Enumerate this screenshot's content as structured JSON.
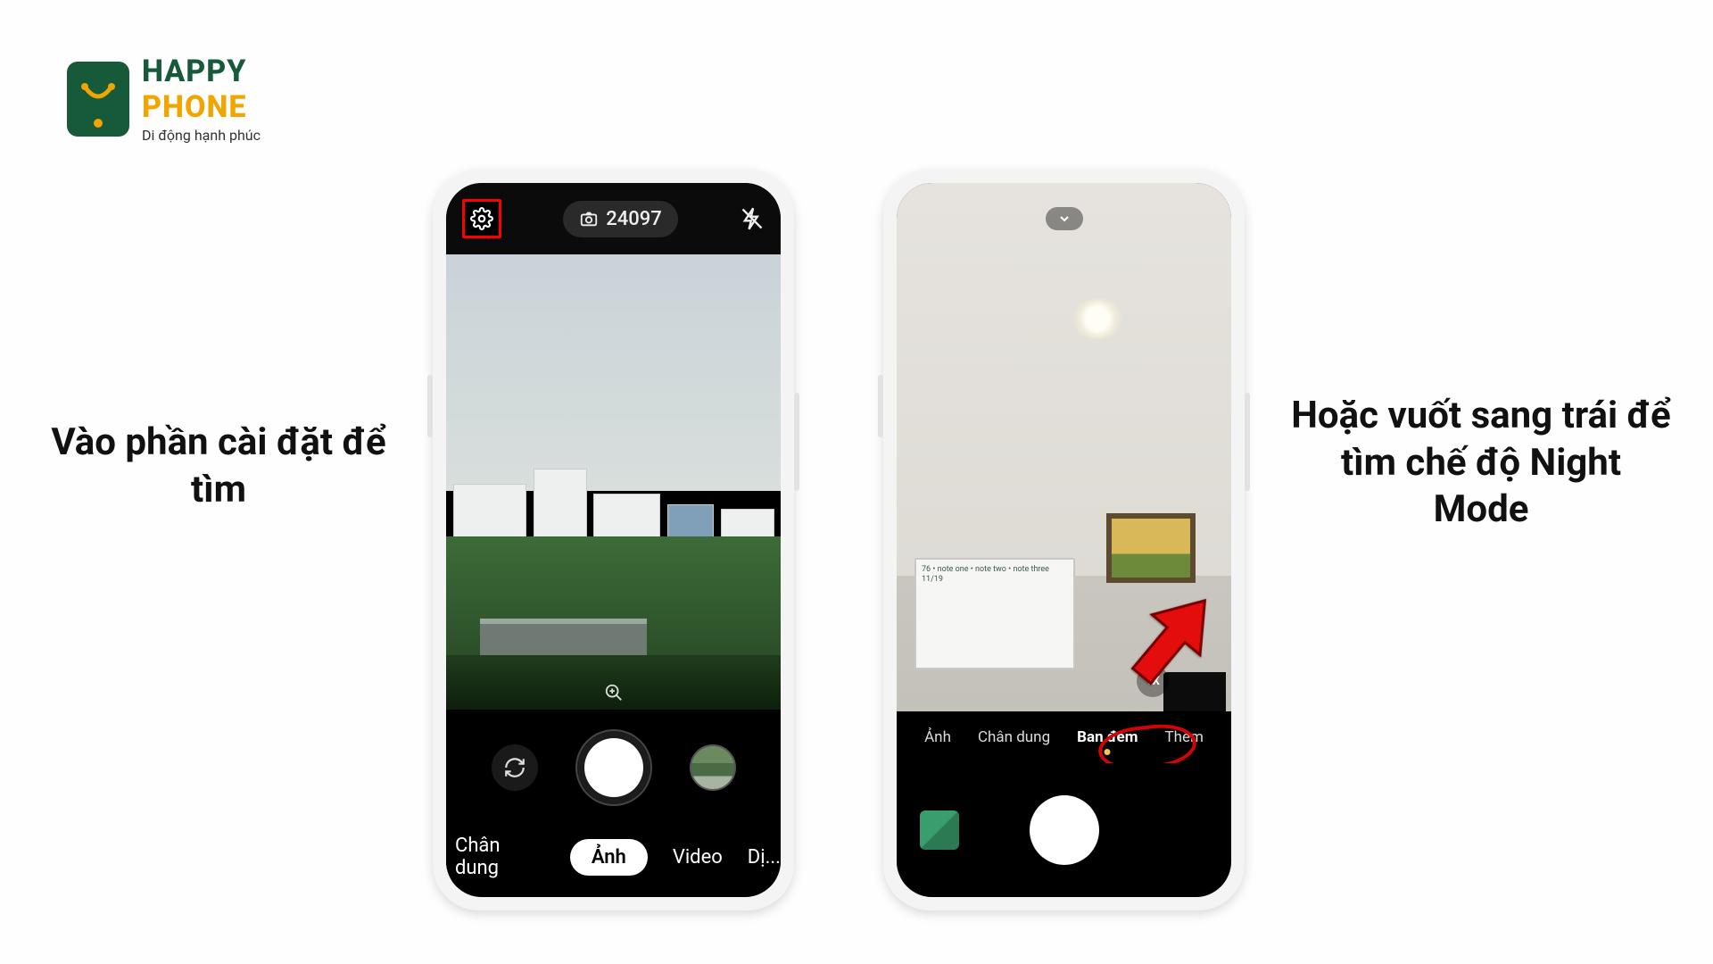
{
  "logo": {
    "line1": "HAPPY",
    "line2": "PHONE",
    "tagline": "Di động hạnh phúc"
  },
  "captions": {
    "left": "Vào phần cài đặt để tìm",
    "right": "Hoặc vuốt sang trái để tìm chế độ Night Mode"
  },
  "phone1": {
    "counter": "24097",
    "modes": {
      "portrait": "Chân dung",
      "photo": "Ảnh",
      "video": "Video",
      "more_truncated": "Dị..."
    },
    "icons": {
      "settings": "gear-icon",
      "camera": "camera-icon",
      "flash_off": "flash-off-icon",
      "zoom": "magnify-icon",
      "switch": "camera-switch-icon"
    }
  },
  "phone2": {
    "zoom": "1X",
    "modes": {
      "photo": "Ảnh",
      "portrait": "Chân dung",
      "night": "Ban đêm",
      "more": "Thêm"
    },
    "whiteboard_text": "76\n• note one\n• note two\n• note three\n11/19"
  }
}
